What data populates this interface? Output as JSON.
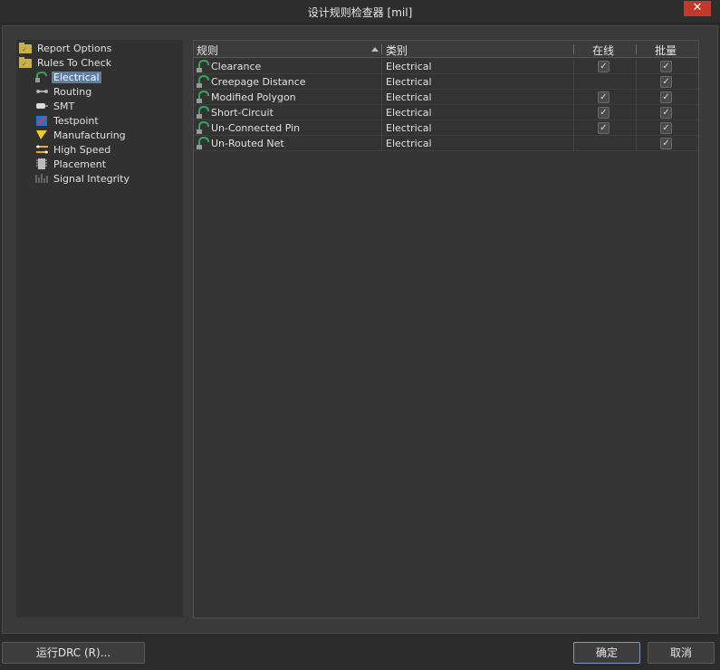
{
  "window": {
    "title": "设计规则检查器 [mil]",
    "close_glyph": "✕"
  },
  "tree": {
    "items": [
      {
        "label": "Report Options",
        "icon": "folder-icon"
      },
      {
        "label": "Rules To Check",
        "icon": "folder-icon"
      },
      {
        "label": "Electrical",
        "icon": "electrical-icon"
      },
      {
        "label": "Routing",
        "icon": "routing-icon"
      },
      {
        "label": "SMT",
        "icon": "smt-icon"
      },
      {
        "label": "Testpoint",
        "icon": "testpoint-icon"
      },
      {
        "label": "Manufacturing",
        "icon": "manufacturing-icon"
      },
      {
        "label": "High Speed",
        "icon": "high-speed-icon"
      },
      {
        "label": "Placement",
        "icon": "placement-icon"
      },
      {
        "label": "Signal Integrity",
        "icon": "signal-integrity-icon"
      }
    ],
    "selected": "Electrical"
  },
  "grid": {
    "headers": {
      "rule": "规则",
      "category": "类别",
      "online": "在线",
      "batch": "批量"
    },
    "rows": [
      {
        "rule": "Clearance",
        "category": "Electrical",
        "online": true,
        "batch": true
      },
      {
        "rule": "Creepage Distance",
        "category": "Electrical",
        "online": false,
        "batch": true
      },
      {
        "rule": "Modified Polygon",
        "category": "Electrical",
        "online": true,
        "batch": true
      },
      {
        "rule": "Short-Circuit",
        "category": "Electrical",
        "online": true,
        "batch": true
      },
      {
        "rule": "Un-Connected Pin",
        "category": "Electrical",
        "online": true,
        "batch": true
      },
      {
        "rule": "Un-Routed Net",
        "category": "Electrical",
        "online": false,
        "batch": true
      }
    ]
  },
  "buttons": {
    "run_drc": "运行DRC (R)...",
    "ok": "确定",
    "cancel": "取消"
  },
  "colors": {
    "selection": "#5d7ea6",
    "close": "#c0392b",
    "rule_icon": "#3aa35a"
  }
}
